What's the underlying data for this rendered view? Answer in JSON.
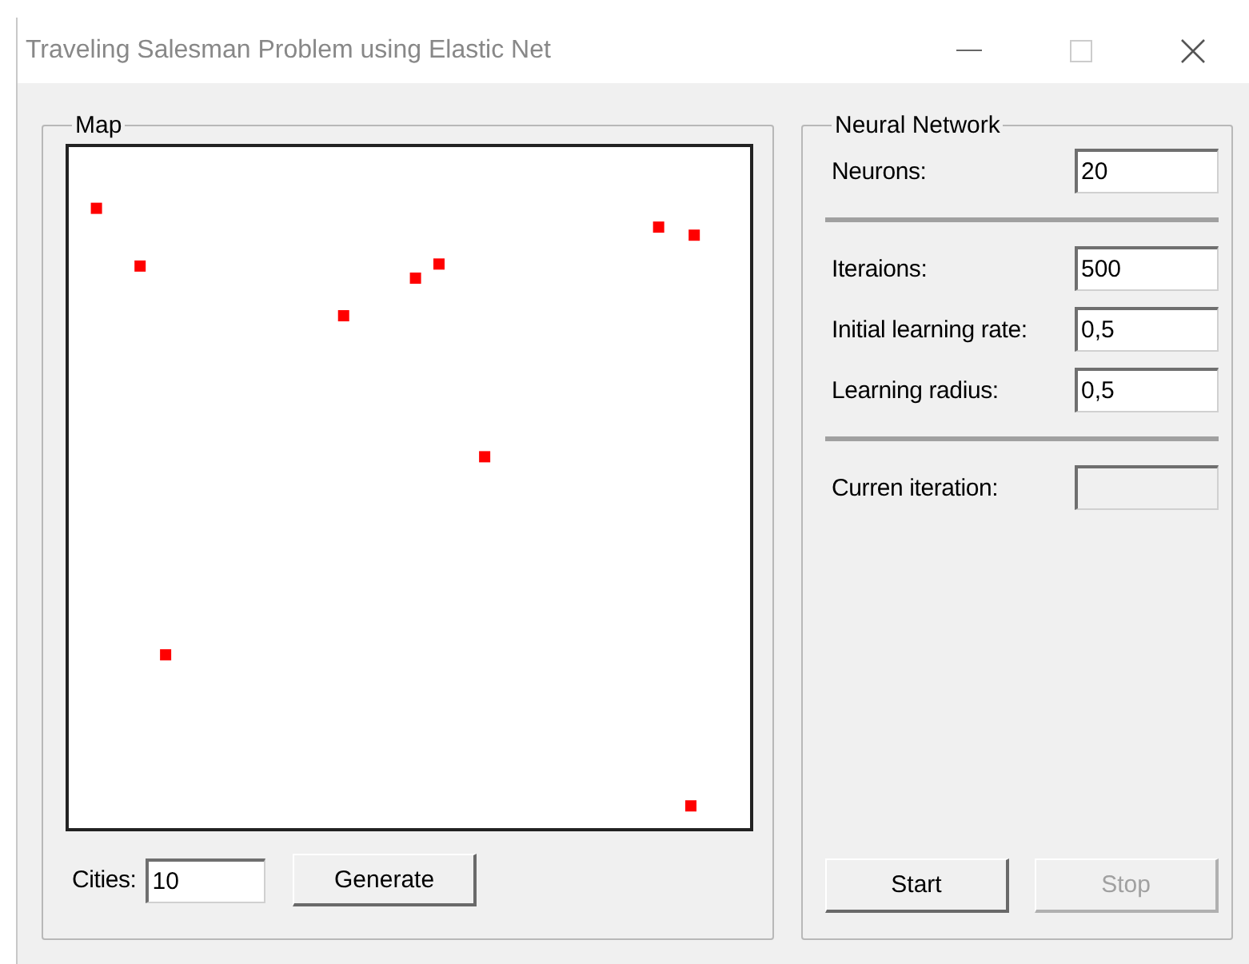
{
  "window": {
    "title": "Traveling Salesman Problem using Elastic Net"
  },
  "map": {
    "title": "Map",
    "cities_label": "Cities:",
    "cities_value": "10",
    "generate_button": "Generate"
  },
  "network": {
    "title": "Neural Network",
    "sections": [
      [
        {
          "label": "Neurons:",
          "value": "20",
          "disabled": false
        }
      ],
      [
        {
          "label": "Iteraions:",
          "value": "500",
          "disabled": false
        },
        {
          "label": "Initial learning rate:",
          "value": "0,5",
          "disabled": false
        },
        {
          "label": "Learning radius:",
          "value": "0,5",
          "disabled": false
        }
      ],
      [
        {
          "label": "Curren iteration:",
          "disabled": true
        }
      ]
    ],
    "buttons": [
      {
        "label": "Start",
        "disabled": false
      },
      {
        "label": "Stop",
        "disabled": true
      }
    ]
  }
}
